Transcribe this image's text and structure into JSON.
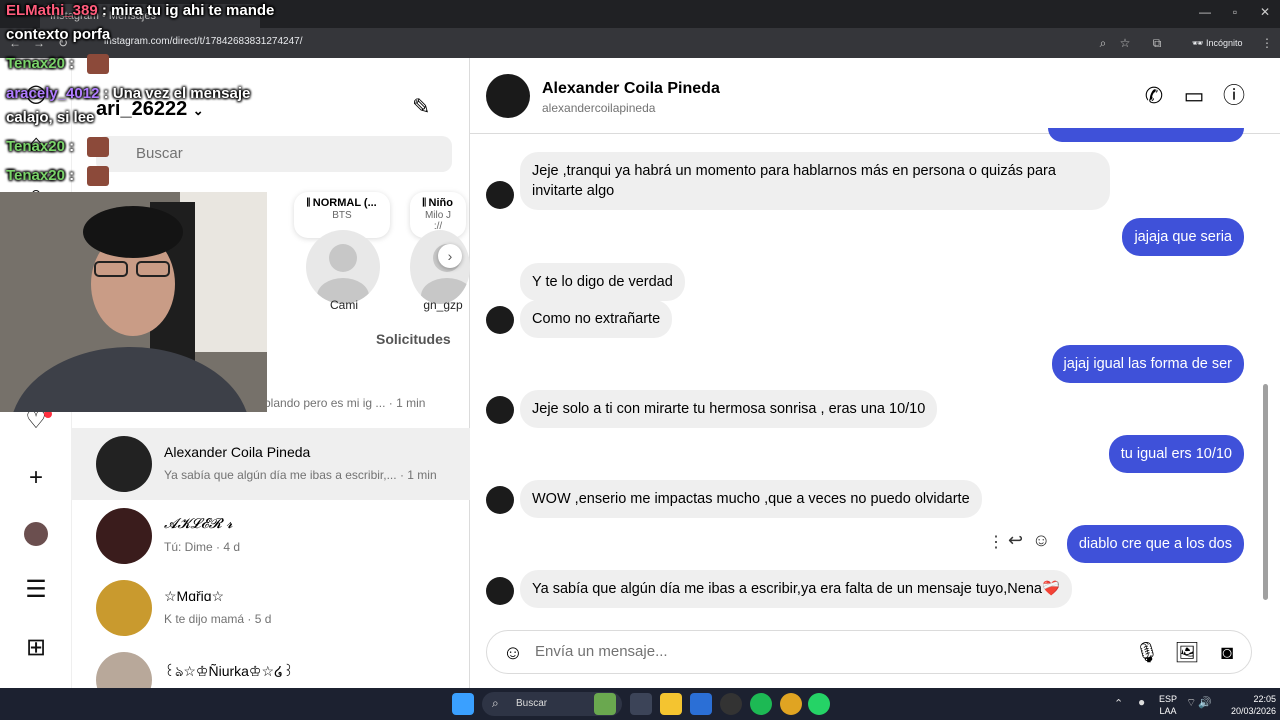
{
  "browser": {
    "tab_title": "Instagram • Mensajes",
    "url": "instagram.com/direct/t/17842683831274247/",
    "incognito_label": "Incógnito"
  },
  "sidebar": {
    "username": "ari_26222",
    "search_placeholder": "Buscar",
    "requests_label": "Solicitudes"
  },
  "notes": [
    {
      "title": "NORMAL (...",
      "subtitle": "BTS"
    },
    {
      "title": "Niño",
      "subtitle": "Milo J",
      "extra": "://"
    }
  ],
  "stories": [
    {
      "name": "Cami"
    },
    {
      "name": "gn_gzp"
    }
  ],
  "chat_list": [
    {
      "name": "",
      "preview": "blando pero es mi ig ...",
      "time": "· 1 min"
    },
    {
      "name": "Alexander Coila Pineda",
      "preview": "Ya sabía que algún día me ibas a escribir,...",
      "time": "· 1 min"
    },
    {
      "name": "𝓐𝓚𝓛𝓔𝓡 𝓻",
      "preview": "Tú: Dime",
      "time": "· 4 d"
    },
    {
      "name": "☆Mɑřiɑ☆",
      "preview": "K te dijo mamá",
      "time": "· 5 d"
    },
    {
      "name": "꒰ঌ☆♔Ñiurka♔☆໒꒱",
      "preview": "",
      "time": ""
    }
  ],
  "stream_overlay": {
    "lines": [
      {
        "user": "ELMathi_389",
        "text": ": mira tu ig ahi te mande"
      },
      {
        "user": "",
        "text": "contexto porfa"
      },
      {
        "user": "Tenax20",
        "text": ":"
      },
      {
        "user": "aracely_4012",
        "text": ": Una vez el mensaje"
      },
      {
        "user": "",
        "text": "calajo, si lee"
      },
      {
        "user": "Tenax20",
        "text": ":"
      },
      {
        "user": "Tenax20",
        "text": ":"
      }
    ]
  },
  "conversation": {
    "contact_name": "Alexander Coila Pineda",
    "contact_handle": "alexandercoilapineda",
    "messages": [
      {
        "dir": "in",
        "text": "Jeje ,tranqui ya habrá un momento para hablarnos más en persona o quizás para invitarte algo"
      },
      {
        "dir": "out",
        "text": "jajaja que seria"
      },
      {
        "dir": "in",
        "text": "Y te lo digo de verdad"
      },
      {
        "dir": "in",
        "text": "Como no extrañarte"
      },
      {
        "dir": "out",
        "text": "jajaj igual las forma de ser"
      },
      {
        "dir": "in",
        "text": "Jeje solo a ti con mirarte tu hermosa sonrisa , eras una 10/10"
      },
      {
        "dir": "out",
        "text": "tu igual ers 10/10"
      },
      {
        "dir": "in",
        "text": "WOW ,enserio me impactas mucho ,que a veces no puedo olvidarte"
      },
      {
        "dir": "out",
        "text": "diablo cre que a los dos"
      },
      {
        "dir": "in",
        "text": "Ya sabía que algún día me ibas  a escribir,ya era falta de un mensaje tuyo,Nena❤️‍🩹"
      }
    ],
    "composer_placeholder": "Envía un mensaje..."
  },
  "taskbar": {
    "search_placeholder": "Buscar",
    "lang_line1": "ESP",
    "lang_line2": "LAA",
    "time": "22:05",
    "date": "20/03/2026"
  },
  "colors": {
    "outgoing_bubble": "#3f51d9",
    "incoming_bubble": "#efefef",
    "taskbar": "#1c2130"
  }
}
